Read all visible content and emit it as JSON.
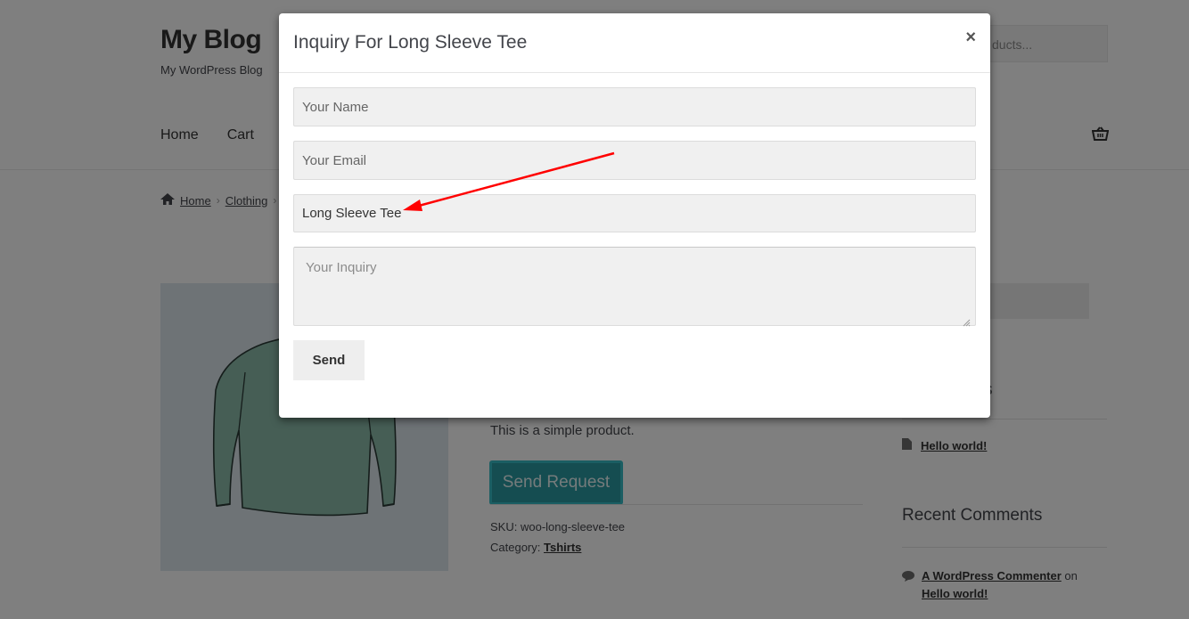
{
  "site": {
    "title": "My Blog",
    "description": "My WordPress Blog",
    "search_placeholder": "ducts..."
  },
  "nav": {
    "items": [
      "Home",
      "Cart"
    ]
  },
  "breadcrumb": {
    "home": "Home",
    "category": "Clothing"
  },
  "product": {
    "short_description": "This is a simple product.",
    "send_request_label": "Send Request",
    "sku_label": "SKU:",
    "sku_value": "woo-long-sleeve-tee",
    "category_label": "Category:",
    "category_value": "Tshirts"
  },
  "sidebar": {
    "recent_post_fragment": "s",
    "recent_post": "Hello world!",
    "recent_comments_title": "Recent Comments",
    "comment_author": "A WordPress Commenter",
    "comment_on": "on",
    "comment_post": "Hello world!"
  },
  "modal": {
    "title": "Inquiry For Long Sleeve Tee",
    "close_glyph": "×",
    "name_placeholder": "Your Name",
    "email_placeholder": "Your Email",
    "product_value": "Long Sleeve Tee",
    "inquiry_placeholder": "Your Inquiry",
    "send_label": "Send"
  },
  "colors": {
    "accent_teal": "#2b9aa3",
    "annotation_arrow": "#ff0000",
    "overlay": "rgba(0,0,0,0.5)"
  },
  "icons": {
    "cart": "basket-icon",
    "home": "home-icon",
    "post": "document-icon",
    "comment": "comment-bubble-icon",
    "close": "close-icon"
  }
}
